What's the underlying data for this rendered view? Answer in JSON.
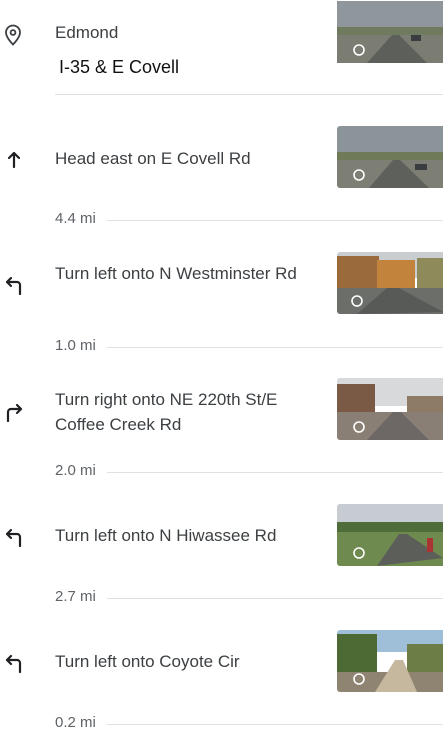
{
  "origin": {
    "place": "Edmond",
    "address": "I-35 & E Covell"
  },
  "steps": [
    {
      "icon": "straight-arrow-icon",
      "instruction": "Head east on E Covell Rd",
      "distance": "4.4 mi"
    },
    {
      "icon": "turn-left-icon",
      "instruction": "Turn left onto N Westminster Rd",
      "distance": "1.0 mi"
    },
    {
      "icon": "turn-right-icon",
      "instruction": "Turn right onto NE 220th St/E Coffee Creek Rd",
      "distance": "2.0 mi"
    },
    {
      "icon": "turn-left-icon",
      "instruction": "Turn left onto N Hiwassee Rd",
      "distance": "2.7 mi"
    },
    {
      "icon": "turn-left-icon",
      "instruction": "Turn left onto Coyote Cir",
      "distance": "0.2 mi"
    }
  ],
  "colors": {
    "text": "#3c4043",
    "secondary": "#5f6368",
    "divider": "#e0e0e0"
  }
}
